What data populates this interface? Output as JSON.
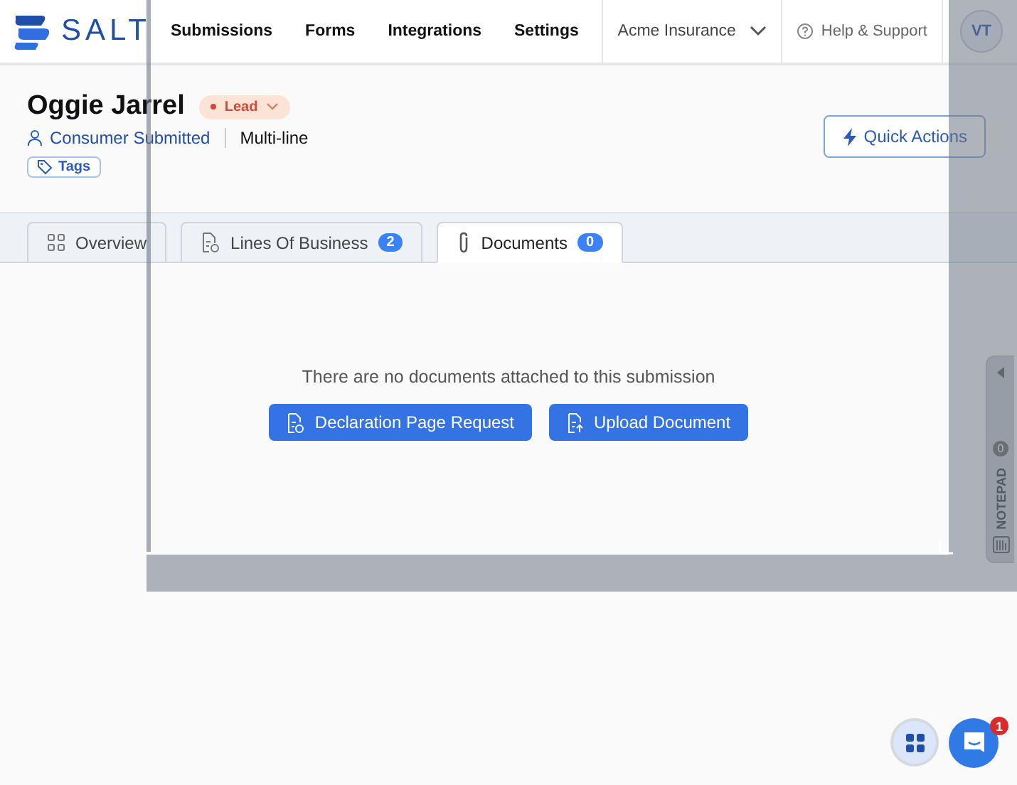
{
  "logo": {
    "text": "SALT"
  },
  "nav": [
    {
      "label": "Submissions"
    },
    {
      "label": "Forms"
    },
    {
      "label": "Integrations"
    },
    {
      "label": "Settings"
    }
  ],
  "account": {
    "label": "Acme Insurance"
  },
  "help": {
    "label": "Help & Support"
  },
  "avatar": {
    "initials": "VT"
  },
  "record": {
    "name": "Oggie Jarrel",
    "status": "Lead",
    "source": "Consumer Submitted",
    "type": "Multi-line",
    "tags": "Tags"
  },
  "quick_actions": "Quick Actions",
  "tabs": [
    {
      "label": "Overview",
      "selected": false
    },
    {
      "label": "Lines Of Business",
      "count": "2",
      "selected": false
    },
    {
      "label": "Documents",
      "count": "0",
      "selected": true
    }
  ],
  "empty_message": "There are no documents attached to this submission",
  "actions": [
    "Declaration Page Request",
    "Upload Document"
  ],
  "notepad": {
    "label": "NOTEPAD",
    "count": "0"
  },
  "chat": {
    "unread": "1"
  }
}
